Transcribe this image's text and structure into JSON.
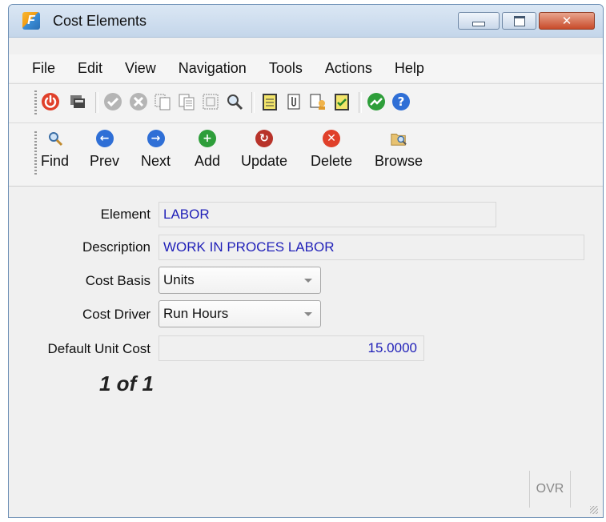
{
  "window": {
    "title": "Cost Elements"
  },
  "menu": [
    "File",
    "Edit",
    "View",
    "Navigation",
    "Tools",
    "Actions",
    "Help"
  ],
  "toolbar_icons": [
    "power-icon",
    "print-icon",
    "check-icon",
    "cancel-icon",
    "copy-icon",
    "paste-icon",
    "select-icon",
    "zoom-icon",
    "notes-icon",
    "attach-icon",
    "user-docs-icon",
    "schedule-icon",
    "graph-icon",
    "help-icon"
  ],
  "nav": {
    "find": "Find",
    "prev": "Prev",
    "next": "Next",
    "add": "Add",
    "update": "Update",
    "delete": "Delete",
    "browse": "Browse"
  },
  "form": {
    "element_label": "Element",
    "element_value": "LABOR",
    "description_label": "Description",
    "description_value": "WORK IN PROCES LABOR",
    "cost_basis_label": "Cost Basis",
    "cost_basis_value": "Units",
    "cost_driver_label": "Cost Driver",
    "cost_driver_value": "Run Hours",
    "default_unit_cost_label": "Default Unit Cost",
    "default_unit_cost_value": "15.0000"
  },
  "record_position": "1 of 1",
  "status": {
    "mode": "OVR"
  }
}
